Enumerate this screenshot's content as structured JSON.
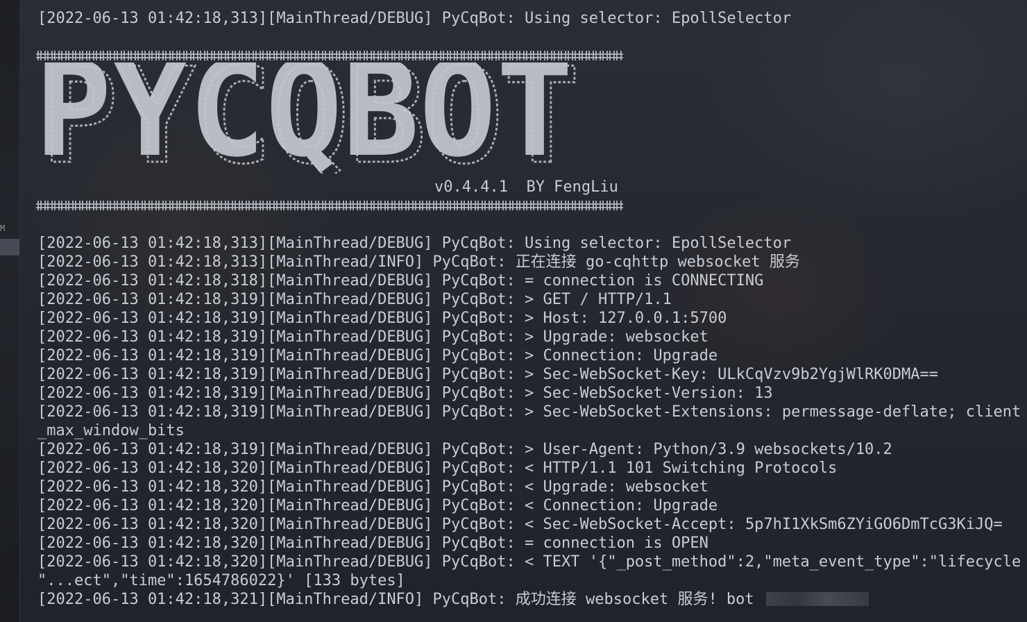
{
  "terminal": {
    "top_line": "[2022-06-13 01:42:18,313][MainThread/DEBUG] PyCqBot: Using selector: EpollSelector",
    "banner": {
      "logo_text": "PYCQBOT",
      "version_line": "v0.4.4.1  BY FengLiu"
    },
    "log_lines": [
      "[2022-06-13 01:42:18,313][MainThread/DEBUG] PyCqBot: Using selector: EpollSelector",
      "[2022-06-13 01:42:18,313][MainThread/INFO] PyCqBot: 正在连接 go-cqhttp websocket 服务",
      "[2022-06-13 01:42:18,318][MainThread/DEBUG] PyCqBot: = connection is CONNECTING",
      "[2022-06-13 01:42:18,319][MainThread/DEBUG] PyCqBot: > GET / HTTP/1.1",
      "[2022-06-13 01:42:18,319][MainThread/DEBUG] PyCqBot: > Host: 127.0.0.1:5700",
      "[2022-06-13 01:42:18,319][MainThread/DEBUG] PyCqBot: > Upgrade: websocket",
      "[2022-06-13 01:42:18,319][MainThread/DEBUG] PyCqBot: > Connection: Upgrade",
      "[2022-06-13 01:42:18,319][MainThread/DEBUG] PyCqBot: > Sec-WebSocket-Key: ULkCqVzv9b2YgjWlRK0DMA==",
      "[2022-06-13 01:42:18,319][MainThread/DEBUG] PyCqBot: > Sec-WebSocket-Version: 13",
      "[2022-06-13 01:42:18,319][MainThread/DEBUG] PyCqBot: > Sec-WebSocket-Extensions: permessage-deflate; client",
      "_max_window_bits",
      "[2022-06-13 01:42:18,319][MainThread/DEBUG] PyCqBot: > User-Agent: Python/3.9 websockets/10.2",
      "[2022-06-13 01:42:18,320][MainThread/DEBUG] PyCqBot: < HTTP/1.1 101 Switching Protocols",
      "[2022-06-13 01:42:18,320][MainThread/DEBUG] PyCqBot: < Upgrade: websocket",
      "[2022-06-13 01:42:18,320][MainThread/DEBUG] PyCqBot: < Connection: Upgrade",
      "[2022-06-13 01:42:18,320][MainThread/DEBUG] PyCqBot: < Sec-WebSocket-Accept: 5p7hI1XkSm6ZYiGO6DmTcG3KiJQ=",
      "[2022-06-13 01:42:18,320][MainThread/DEBUG] PyCqBot: = connection is OPEN",
      "[2022-06-13 01:42:18,320][MainThread/DEBUG] PyCqBot: < TEXT '{\"_post_method\":2,\"meta_event_type\":\"lifecycle",
      "\"...ect\",\"time\":1654786022}' [133 bytes]"
    ],
    "last_line": "[2022-06-13 01:42:18,321][MainThread/INFO] PyCqBot: 成功连接 websocket 服务! bot "
  },
  "left_strip": {
    "glyph": "M"
  }
}
